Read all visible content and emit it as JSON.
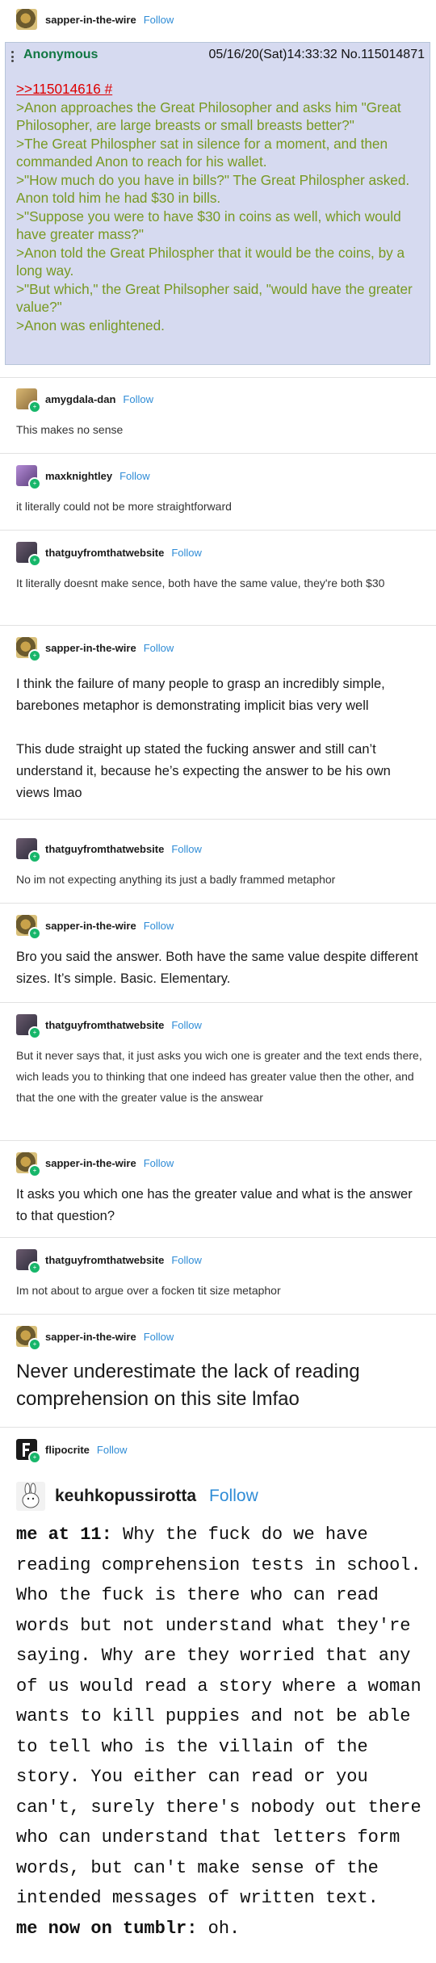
{
  "follow_label": "Follow",
  "p1": {
    "username": "sapper-in-the-wire",
    "greentext_block": {
      "name": "Anonymous",
      "datetime": "05/16/20(Sat)14:33:32 No.115014871",
      "quote_link": ">>115014616 #",
      "lines": [
        ">Anon approaches the Great Philosopher and asks him \"Great Philosopher, are large breasts or small breasts better?\"",
        ">The Great Philospher sat in silence for a moment, and then commanded Anon to reach for his wallet.",
        ">\"How much do you have in bills?\" The Great Philospher asked. Anon told him he had $30 in bills.",
        ">\"Suppose you were to have $30 in coins as well, which would have greater mass?\"",
        ">Anon told the Great Philospher that it would be the coins, by a long way.",
        ">\"But which,\" the Great Philsopher said, \"would have the greater value?\"",
        ">Anon was enlightened."
      ]
    }
  },
  "p2": {
    "username": "amygdala-dan",
    "text": "This makes no sense"
  },
  "p3": {
    "username": "maxknightley",
    "text": "it literally could not be more straightforward"
  },
  "p4": {
    "username": "thatguyfromthatwebsite",
    "text": "It literally doesnt make sence, both have the same value, they're both $30"
  },
  "p5": {
    "username": "sapper-in-the-wire",
    "para1": "I think the failure of many people to grasp an incredibly simple, barebones metaphor is demonstrating implicit bias very well",
    "para2": "This dude straight up stated the fucking answer and still can’t understand it, because he’s expecting the answer to be his own views lmao"
  },
  "p6": {
    "username": "thatguyfromthatwebsite",
    "text": "No im not expecting anything its just a badly frammed metaphor"
  },
  "p7": {
    "username": "sapper-in-the-wire",
    "text": "Bro you said the answer. Both have the same value despite different sizes. It’s simple. Basic. Elementary."
  },
  "p8": {
    "username": "thatguyfromthatwebsite",
    "text": "But it never says that, it just asks you wich one is greater and the text ends there, wich leads you to thinking that one indeed has greater value then the other, and that the one with the greater value is the answear"
  },
  "p9": {
    "username": "sapper-in-the-wire",
    "text": "It asks you which one has the greater value and what is the answer to that question?"
  },
  "p10": {
    "username": "thatguyfromthatwebsite",
    "text": "Im not about to argue over a focken tit size metaphor"
  },
  "p11": {
    "username": "sapper-in-the-wire",
    "text": "Never underestimate the lack of reading comprehension on this site lmfao"
  },
  "p12": {
    "username": "flipocrite",
    "embedded_username": "keuhkopussirotta",
    "lead1": "me at 11:",
    "body1": " Why the fuck do we have reading comprehension tests in school. Who the fuck is there who can read words but not understand what they're saying. Why are they worried that any of us would read a story where a woman wants to kill puppies and not be able to tell who is the villain of the story. You either can read or you can't, surely there's nobody out there who can understand that letters form words, but can't make sense of the intended messages of written text.",
    "lead2": "me now on tumblr:",
    "body2": " oh."
  }
}
